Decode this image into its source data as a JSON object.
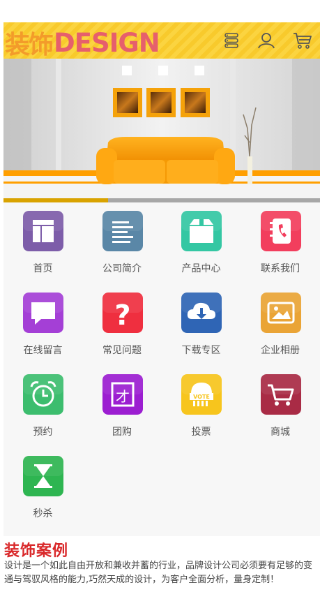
{
  "header": {
    "logo_cn": "装饰",
    "logo_en": "DESIGN",
    "icons": [
      "menu-icon",
      "user-icon",
      "cart-icon"
    ]
  },
  "banner": {
    "progress_fraction": 0.33
  },
  "nav": {
    "items": [
      {
        "label": "首页",
        "icon": "home-icon",
        "color": "#7d5da9"
      },
      {
        "label": "公司简介",
        "icon": "document-icon",
        "color": "#5a87a7"
      },
      {
        "label": "产品中心",
        "icon": "box-icon",
        "color": "#34c7a3"
      },
      {
        "label": "联系我们",
        "icon": "contact-book-icon",
        "color": "#f23e5d"
      },
      {
        "label": "在线留言",
        "icon": "message-icon",
        "color": "#a43fd6"
      },
      {
        "label": "常见问题",
        "icon": "question-icon",
        "color": "#ef2f3f"
      },
      {
        "label": "下载专区",
        "icon": "cloud-download-icon",
        "color": "#2f65b5"
      },
      {
        "label": "企业相册",
        "icon": "photo-album-icon",
        "color": "#eaa436"
      },
      {
        "label": "预约",
        "icon": "alarm-clock-icon",
        "color": "#3cbd6e"
      },
      {
        "label": "团购",
        "icon": "group-buy-icon",
        "color": "#9c1ed1"
      },
      {
        "label": "投票",
        "icon": "vote-icon",
        "color": "#f7c51d"
      },
      {
        "label": "商城",
        "icon": "shopping-cart-icon",
        "color": "#a92b45"
      },
      {
        "label": "秒杀",
        "icon": "hourglass-icon",
        "color": "#2eb551"
      }
    ]
  },
  "case_section": {
    "title": "装饰案例",
    "text": "设计是一个如此自由开放和兼收并蓄的行业，品牌设计公司必须要有足够的变通与驾驭风格的能力,巧然天成的设计，为客户全面分析，量身定制！"
  }
}
